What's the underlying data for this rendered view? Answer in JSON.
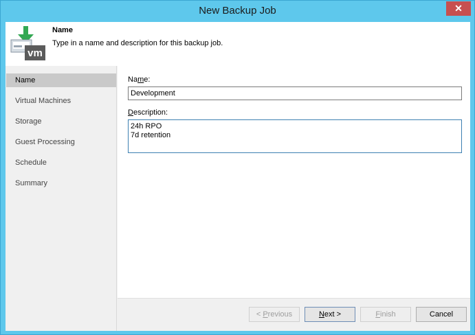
{
  "window": {
    "title": "New Backup Job",
    "close_glyph": "✕"
  },
  "header": {
    "icon": "vm-backup-icon",
    "icon_text": "vm",
    "title": "Name",
    "description": "Type in a name and description for this backup job."
  },
  "sidebar": {
    "items": [
      {
        "label": "Name",
        "active": true
      },
      {
        "label": "Virtual Machines"
      },
      {
        "label": "Storage"
      },
      {
        "label": "Guest Processing"
      },
      {
        "label": "Schedule"
      },
      {
        "label": "Summary"
      }
    ]
  },
  "form": {
    "name_label_pre": "Na",
    "name_label_key": "m",
    "name_label_post": "e:",
    "name_value": "Development",
    "description_label_key": "D",
    "description_label_post": "escription:",
    "description_value": "24h RPO\n7d retention"
  },
  "buttons": {
    "previous_pre": "< ",
    "previous_key": "P",
    "previous_post": "revious",
    "next_key": "N",
    "next_post": "ext >",
    "finish_key": "F",
    "finish_post": "inish",
    "cancel": "Cancel"
  },
  "colors": {
    "titlebar": "#5ec8ec",
    "close": "#c75050",
    "accent_green": "#33a853"
  }
}
